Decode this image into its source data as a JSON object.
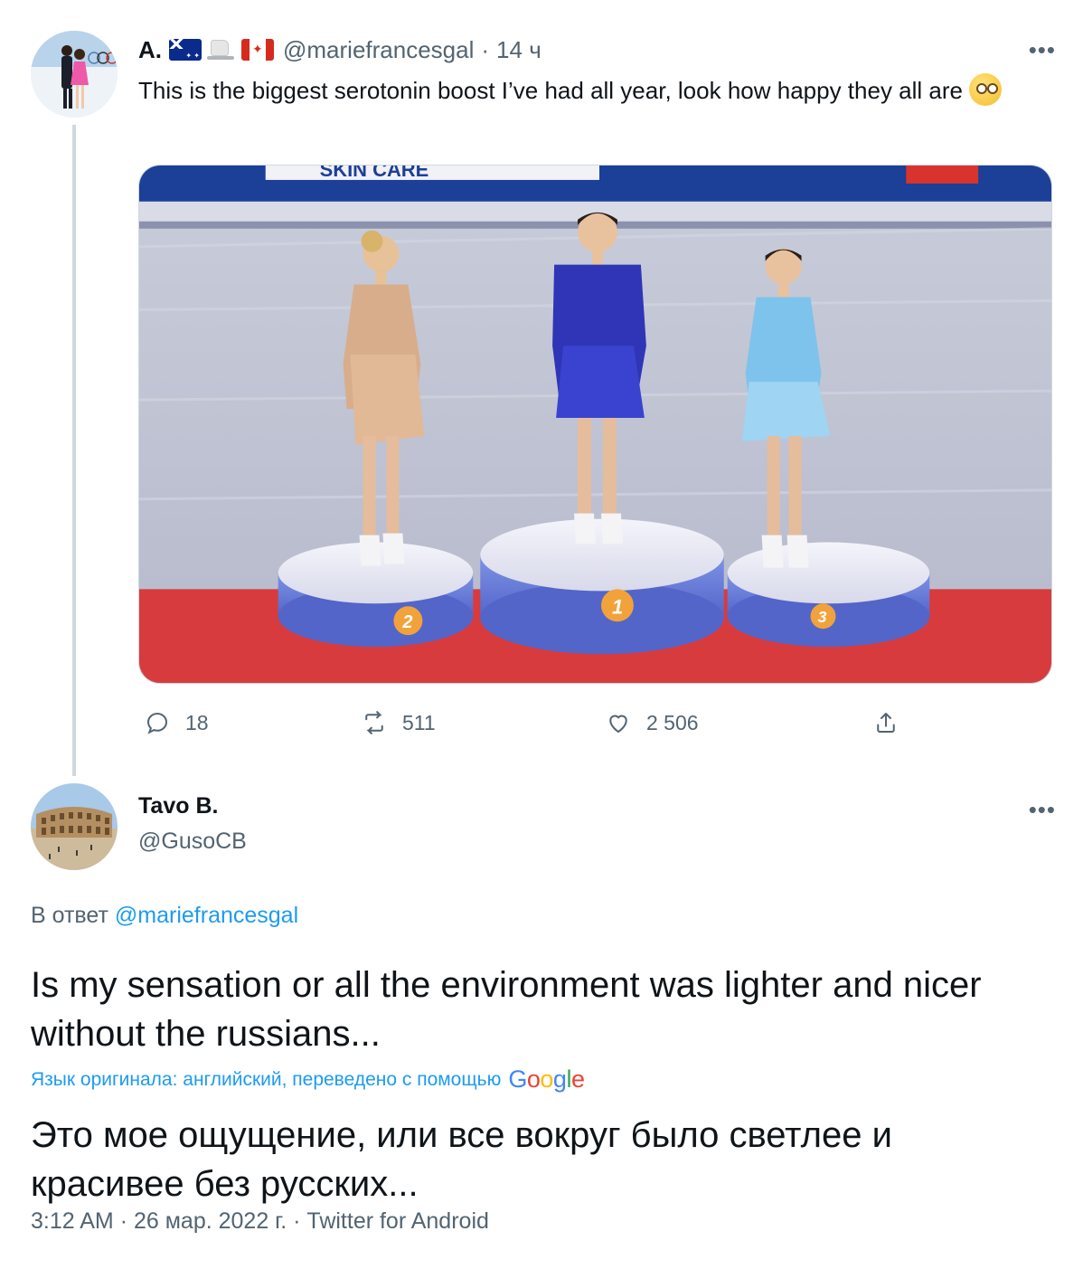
{
  "parent_tweet": {
    "display_name": "A.",
    "flag_icons": [
      "australia-flag-icon",
      "ice-skate-icon",
      "canada-flag-icon"
    ],
    "handle": "@mariefrancesgal",
    "separator": "·",
    "time": "14 ч",
    "more": "•••",
    "text": "This is the biggest serotonin boost I’ve had all year, look how happy they all are",
    "emoji": "face-with-rolling-eyes-icon",
    "media": {
      "banner_text": "SKIN CARE",
      "podium_numbers": [
        "2",
        "1",
        "3"
      ]
    },
    "actions": {
      "replies": "18",
      "retweets": "511",
      "likes": "2 506"
    }
  },
  "reply_tweet": {
    "display_name": "Tavo B.",
    "handle": "@GusoCB",
    "more": "•••",
    "reply_prefix": "В ответ",
    "reply_mention": "@mariefrancesgal",
    "text": "Is my sensation or all the environment was lighter and nicer without the russians...",
    "translation_note": "Язык оригинала: английский, переведено с помощью",
    "translation_provider": "Google",
    "translated_text": "Это мое ощущение, или все вокруг было светлее и красивее без русских...",
    "meta": {
      "time": "3:12 AM",
      "date": "26 мар. 2022 г.",
      "source": "Twitter for Android",
      "separator": "·"
    }
  },
  "colors": {
    "accent": "#1d9bf0",
    "secondary_text": "#536471",
    "primary_text": "#0f1419",
    "thread_line": "#cfd9de"
  }
}
